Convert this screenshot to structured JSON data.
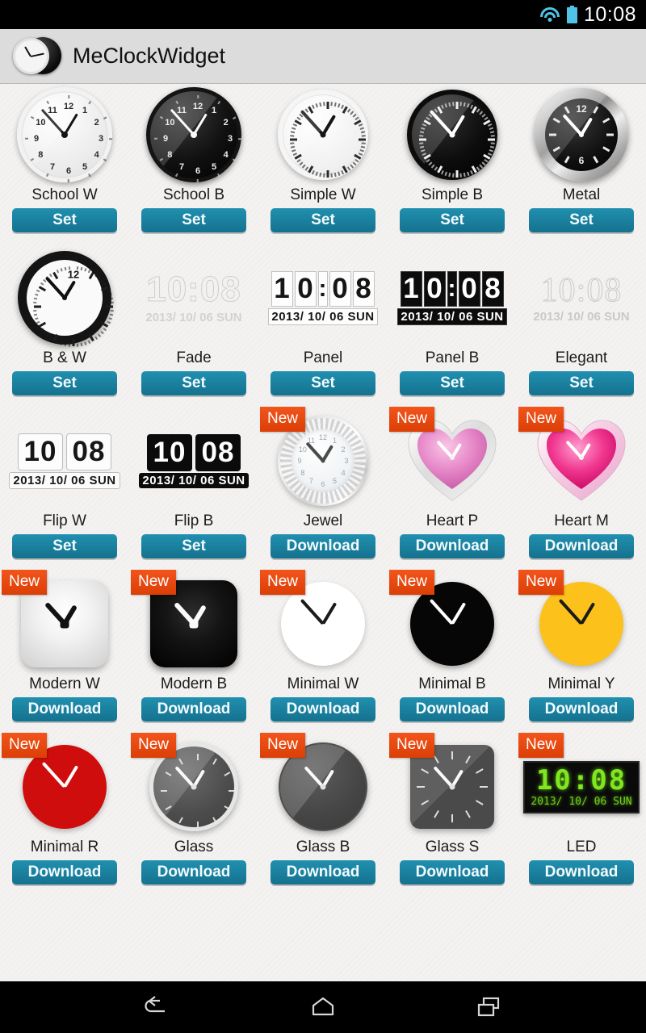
{
  "status_bar": {
    "time": "10:08",
    "icons": [
      "wifi-icon",
      "battery-icon"
    ]
  },
  "action_bar": {
    "app_title": "MeClockWidget",
    "app_icon": "clock-app-icon"
  },
  "clock_display": {
    "time": "10:08",
    "hour": "10",
    "minute": "08",
    "separator": ":",
    "date": "2013/ 10/ 06",
    "weekday": "SUN",
    "date_full": "2013/ 10/ 06 SUN"
  },
  "buttons": {
    "set_label": "Set",
    "download_label": "Download",
    "button_color": "#1a7f9e"
  },
  "badge": {
    "new_label": "New",
    "badge_color": "#e2450c"
  },
  "nav_bar": {
    "back_label": "back-icon",
    "home_label": "home-icon",
    "recents_label": "recents-icon"
  },
  "grid": {
    "rows": [
      [
        {
          "name": "School W",
          "action": "Set",
          "new": false
        },
        {
          "name": "School B",
          "action": "Set",
          "new": false
        },
        {
          "name": "Simple W",
          "action": "Set",
          "new": false
        },
        {
          "name": "Simple B",
          "action": "Set",
          "new": false
        },
        {
          "name": "Metal",
          "action": "Set",
          "new": false
        }
      ],
      [
        {
          "name": "B & W",
          "action": "Set",
          "new": false
        },
        {
          "name": "Fade",
          "action": "Set",
          "new": false
        },
        {
          "name": "Panel",
          "action": "Set",
          "new": false
        },
        {
          "name": "Panel B",
          "action": "Set",
          "new": false
        },
        {
          "name": "Elegant",
          "action": "Set",
          "new": false
        }
      ],
      [
        {
          "name": "Flip W",
          "action": "Set",
          "new": false
        },
        {
          "name": "Flip B",
          "action": "Set",
          "new": false
        },
        {
          "name": "Jewel",
          "action": "Download",
          "new": true
        },
        {
          "name": "Heart P",
          "action": "Download",
          "new": true
        },
        {
          "name": "Heart M",
          "action": "Download",
          "new": true
        }
      ],
      [
        {
          "name": "Modern W",
          "action": "Download",
          "new": true
        },
        {
          "name": "Modern B",
          "action": "Download",
          "new": true
        },
        {
          "name": "Minimal W",
          "action": "Download",
          "new": true
        },
        {
          "name": "Minimal B",
          "action": "Download",
          "new": true
        },
        {
          "name": "Minimal Y",
          "action": "Download",
          "new": true
        }
      ],
      [
        {
          "name": "Minimal R",
          "action": "Download",
          "new": true
        },
        {
          "name": "Glass",
          "action": "Download",
          "new": true
        },
        {
          "name": "Glass B",
          "action": "Download",
          "new": true
        },
        {
          "name": "Glass S",
          "action": "Download",
          "new": true
        },
        {
          "name": "LED",
          "action": "Download",
          "new": true
        }
      ]
    ]
  }
}
